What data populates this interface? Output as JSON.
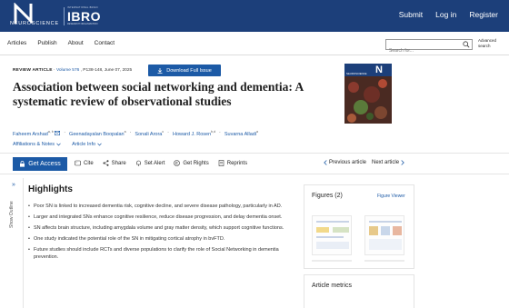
{
  "brand": {
    "logo_text": "NEUROSCIENCE",
    "ibro_small": "INTERNATIONAL BRAIN",
    "ibro_name": "IBRO",
    "ibro_sub": "RESEARCH ORGANIZATION"
  },
  "top_links": [
    "Submit",
    "Log in",
    "Register"
  ],
  "nav": {
    "links": [
      "Articles",
      "Publish",
      "About",
      "Contact"
    ],
    "search_placeholder": "Search for...",
    "advanced_search": "Advanced search"
  },
  "article": {
    "type": "REVIEW ARTICLE",
    "volume": "Volume 576",
    "pages_date": ", P138-148, June 07, 2025",
    "download_label": "Download Full Issue",
    "title": "Association between social networking and dementia: A systematic review of observational studies",
    "authors": [
      {
        "name": "Faheem Arshad",
        "sup": "a, b"
      },
      {
        "name": "Geenadayalan Boopalan",
        "sup": "a"
      },
      {
        "name": "Sonali Arora",
        "sup": "c"
      },
      {
        "name": "Howard J. Rosen",
        "sup": "b,d"
      },
      {
        "name": "Suvarna Alladi",
        "sup": "a"
      }
    ],
    "affiliations_label": "Affiliations & Notes",
    "article_info_label": "Article Info"
  },
  "cover": {
    "letter": "N",
    "label": "NEUROSCIENCE"
  },
  "actions": {
    "get_access": "Get Access",
    "items": [
      "Cite",
      "Share",
      "Set Alert",
      "Get Rights",
      "Reprints"
    ],
    "previous": "Previous article",
    "next": "Next article"
  },
  "outline": {
    "label": "Show Outline"
  },
  "highlights": {
    "title": "Highlights",
    "items": [
      "Poor SN is linked to increased dementia risk, cognitive decline, and severe disease pathology, particularly in AD.",
      "Larger and integrated SNs enhance cognitive resilience, reduce disease progression, and delay dementia onset.",
      "SN affects brain structure, including amygdala volume and gray matter density, which support cognitive functions.",
      "One study indicated the potential role of the SN in mitigating cortical atrophy in bvFTD.",
      "Future studies should include RCTs and diverse populations to clarify the role of Social Networking in dementia prevention."
    ]
  },
  "figures": {
    "title": "Figures (2)",
    "viewer": "Figure Viewer"
  },
  "metrics": {
    "title": "Article metrics"
  },
  "colors": {
    "brand_navy": "#1c3f7a",
    "accent_blue": "#1c5aa6"
  }
}
